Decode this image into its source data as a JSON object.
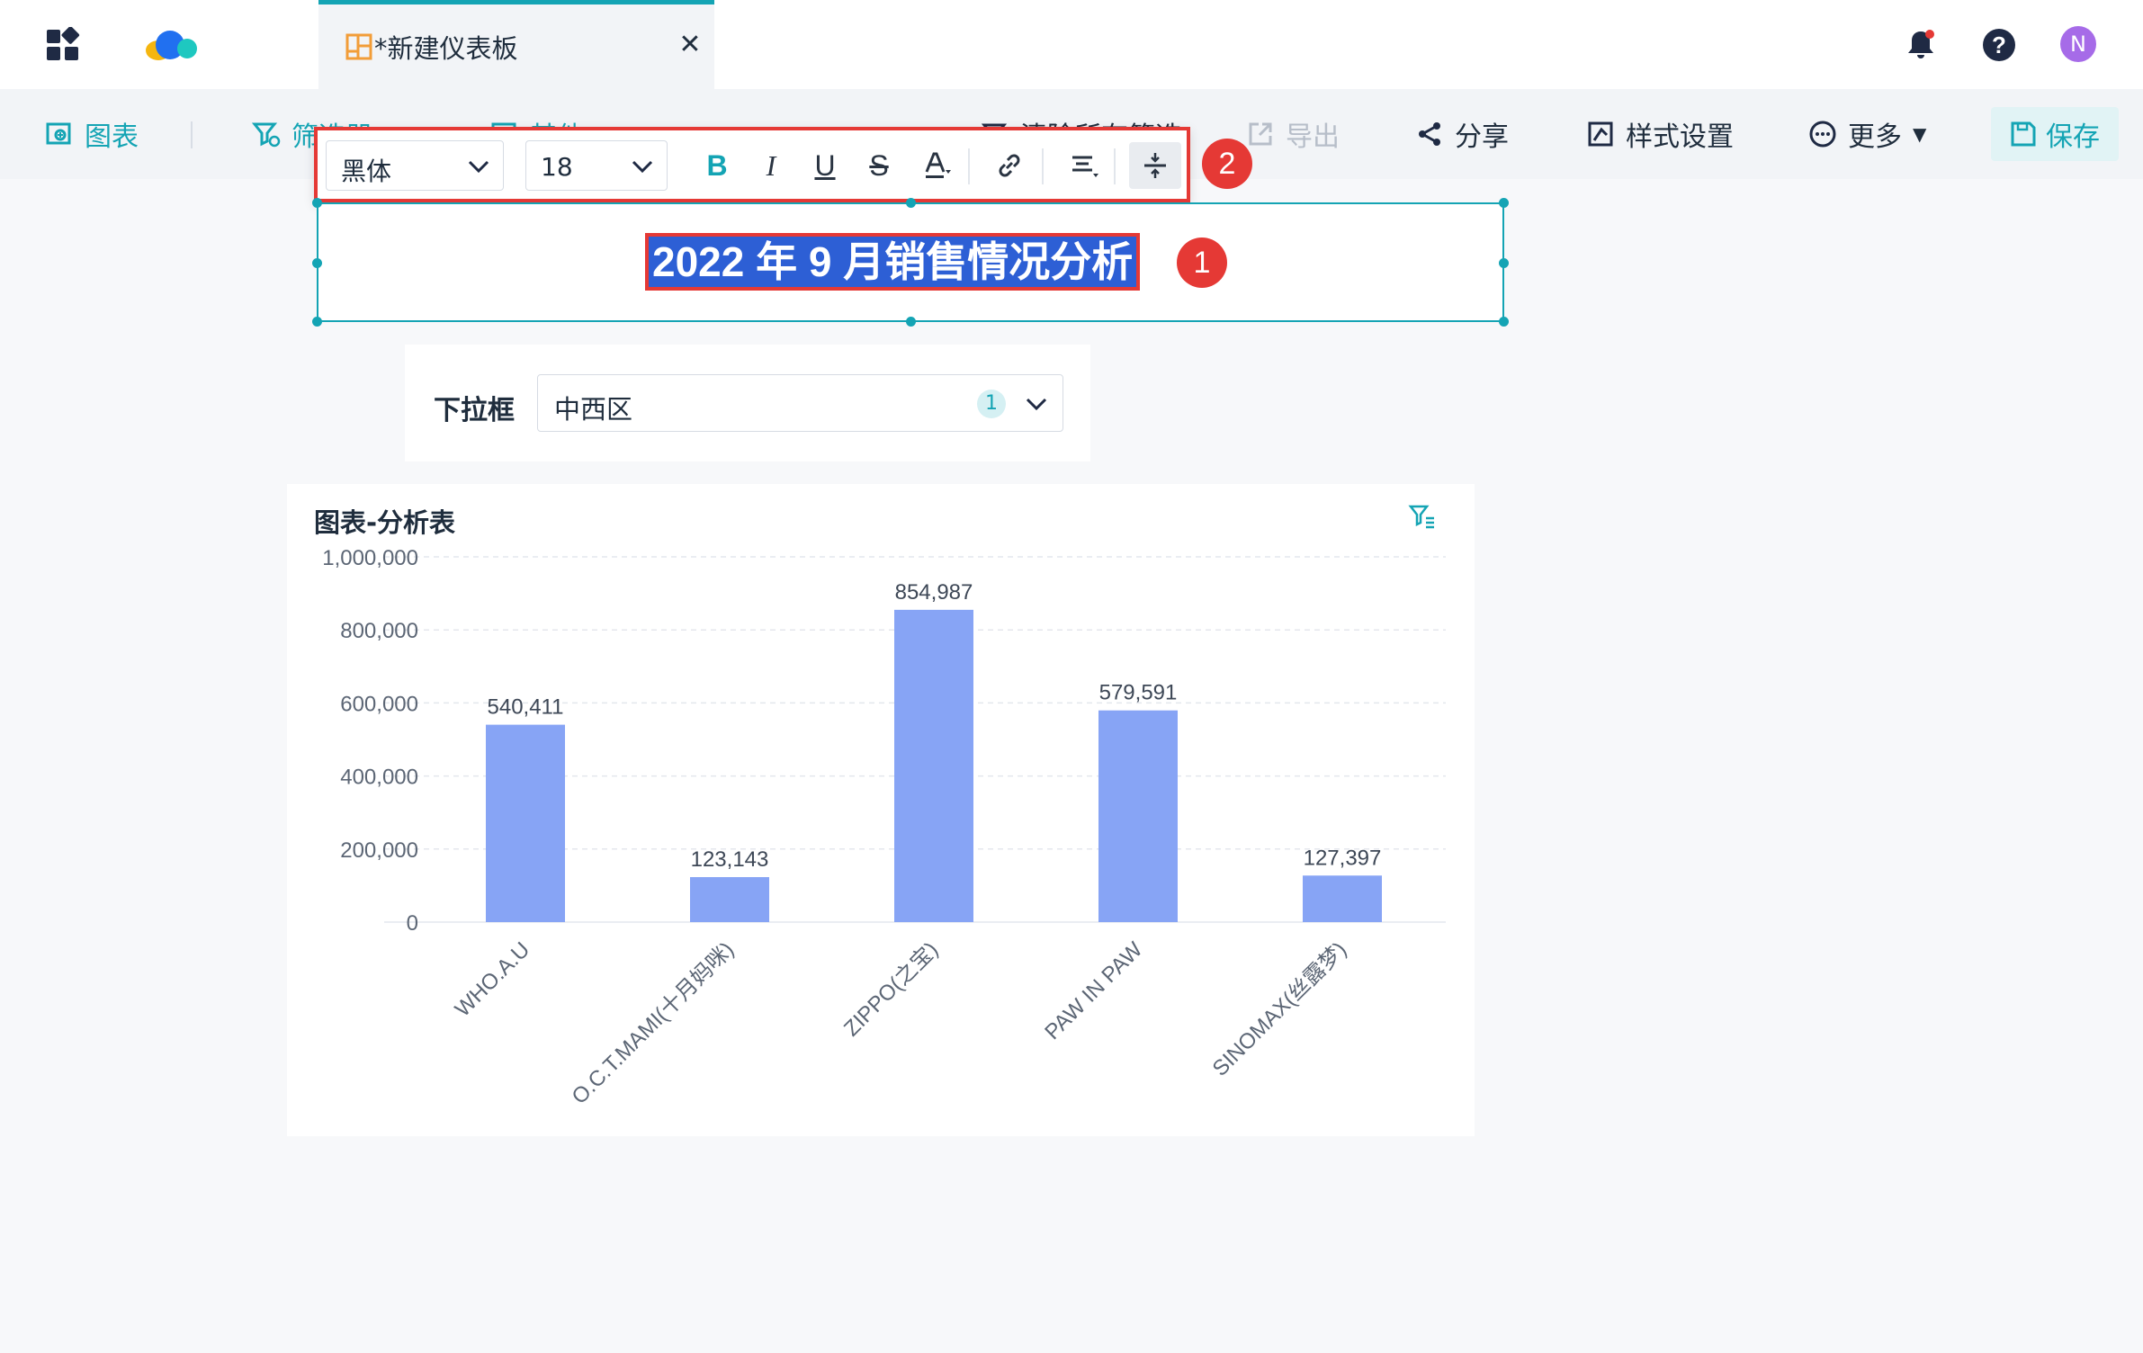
{
  "header": {
    "tab_label": "*新建仪表板",
    "avatar_letter": "N"
  },
  "toolbar": {
    "chart": "图表",
    "filter": "筛选器",
    "other": "其他",
    "clear_filters": "清除所有筛选",
    "export": "导出",
    "share": "分享",
    "style": "样式设置",
    "more": "更多",
    "save": "保存"
  },
  "format_bar": {
    "font_family": "黑体",
    "font_size": "18",
    "badge": "2"
  },
  "title_widget": {
    "text": "2022 年 9 月销售情况分析",
    "badge": "1"
  },
  "dropdown_widget": {
    "label": "下拉框",
    "value": "中西区",
    "count": "1"
  },
  "chart": {
    "title": "图表-分析表"
  },
  "colors": {
    "accent": "#14a4b4",
    "bar": "#87a4f5",
    "highlight": "#2d5fd5",
    "annotation": "#e53935"
  },
  "chart_data": {
    "type": "bar",
    "categories": [
      "WHO.A.U",
      "O.C.T.MAMI(十月妈咪)",
      "ZIPPO(之宝)",
      "PAW IN PAW",
      "SINOMAX(丝露梦)"
    ],
    "values": [
      540411,
      123143,
      854987,
      579591,
      127397
    ],
    "value_labels": [
      "540,411",
      "123,143",
      "854,987",
      "579,591",
      "127,397"
    ],
    "y_ticks": [
      "0",
      "200,000",
      "400,000",
      "600,000",
      "800,000",
      "1,000,000"
    ],
    "ylim": [
      0,
      1000000
    ],
    "grid": true,
    "legend": "none"
  }
}
